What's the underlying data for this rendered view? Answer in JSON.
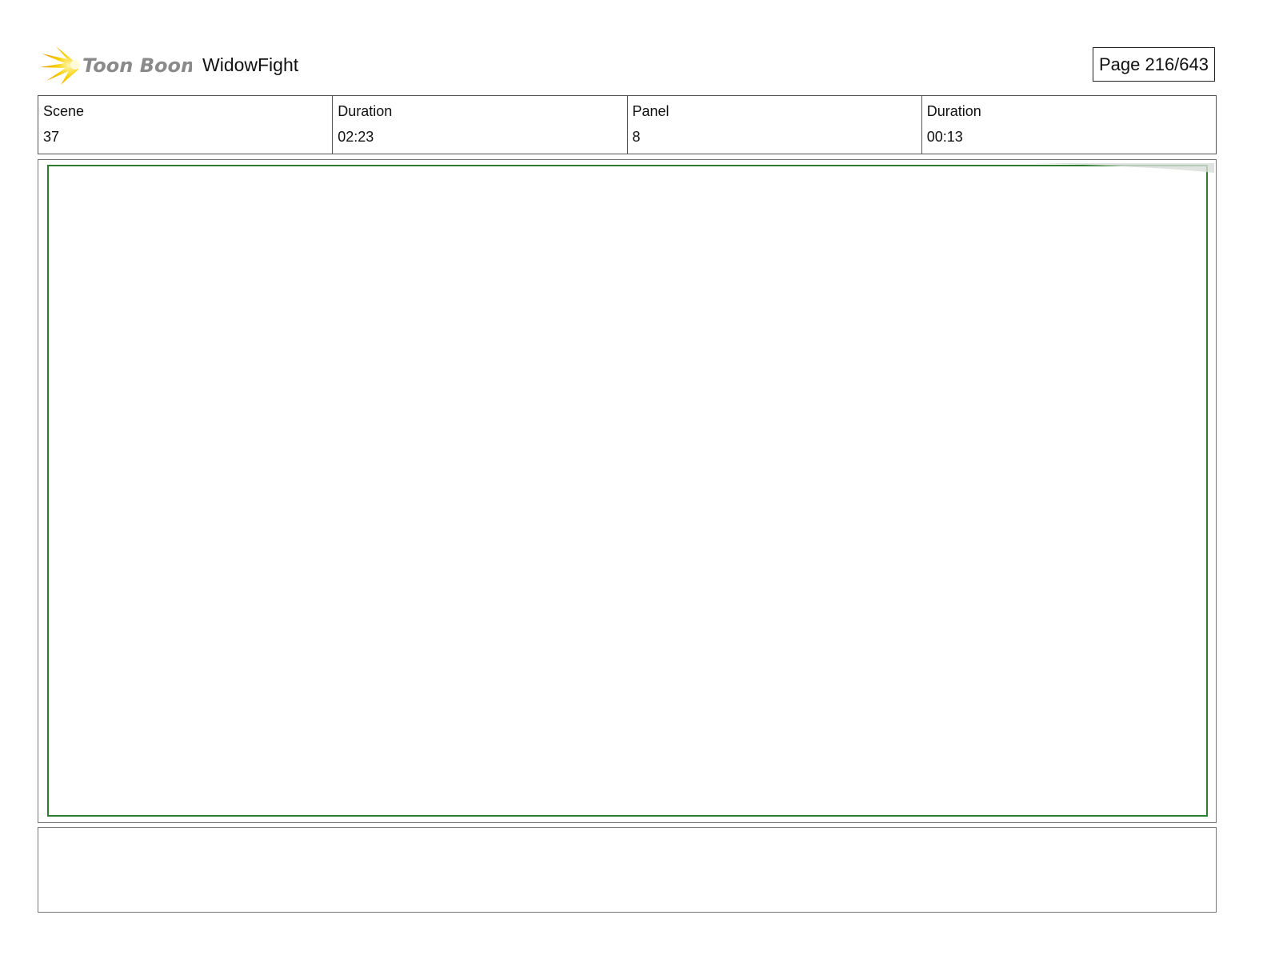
{
  "header": {
    "brand": "Toon Boom",
    "project_title": "WidowFight",
    "page_label": "Page 216/643"
  },
  "info": {
    "scene_label": "Scene",
    "scene_value": "37",
    "scene_duration_label": "Duration",
    "scene_duration_value": "02:23",
    "panel_label": "Panel",
    "panel_value": "8",
    "panel_duration_label": "Duration",
    "panel_duration_value": "00:13"
  },
  "colors": {
    "panel_border": "#2e7d2e",
    "logo_yellow": "#f5c400",
    "logo_text": "#8a8a8a"
  }
}
